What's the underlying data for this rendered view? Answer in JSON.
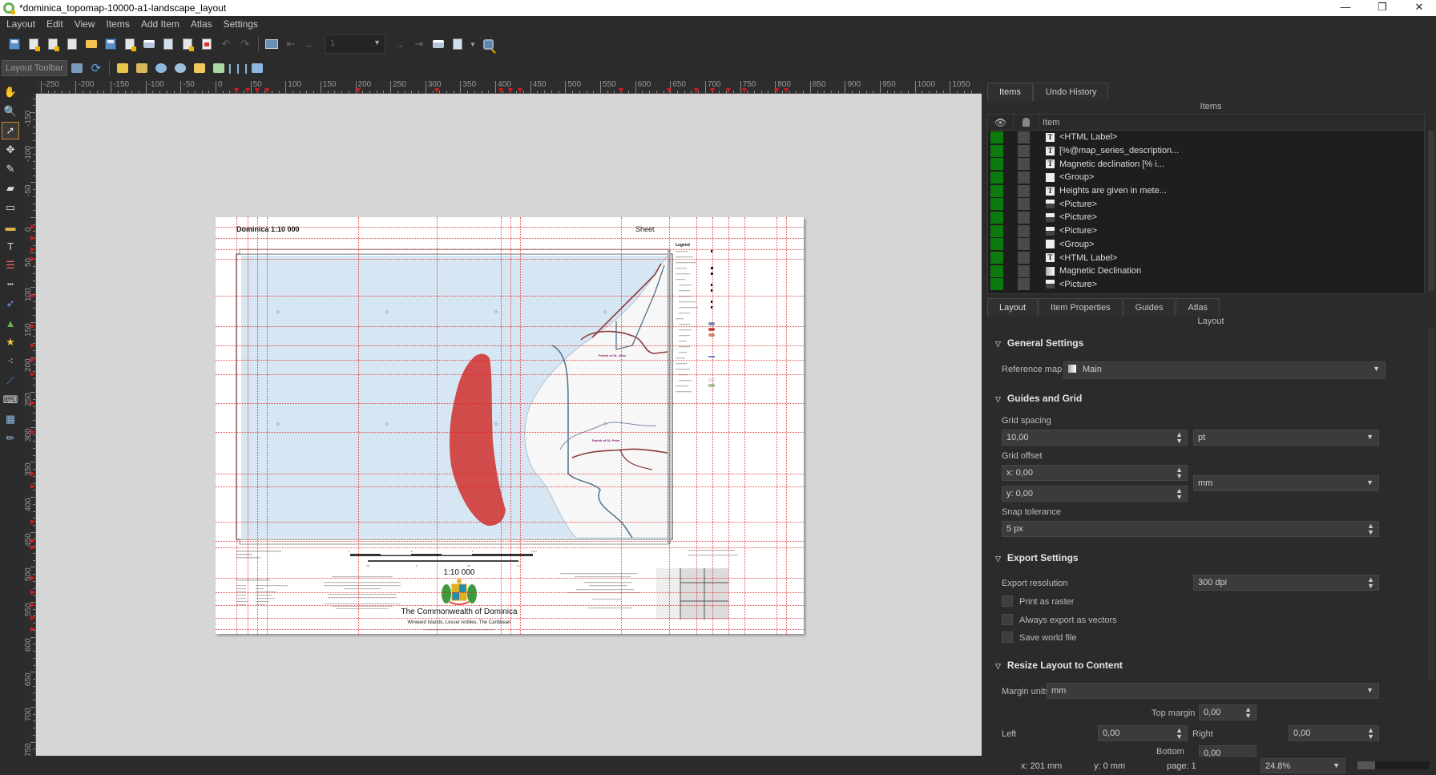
{
  "window": {
    "title": "*dominica_topomap-10000-a1-landscape_layout",
    "controls": {
      "minimize": "—",
      "restore": "❐",
      "close": "✕"
    }
  },
  "menu": [
    "Layout",
    "Edit",
    "View",
    "Items",
    "Add Item",
    "Atlas",
    "Settings"
  ],
  "toolbar": {
    "page_combo_value": "1",
    "layout_toolbar_label": "Layout Toolbar",
    "icons": [
      "save-icon",
      "new-layout-icon",
      "duplicate-layout-icon",
      "layout-manager-icon",
      "open-template-icon",
      "save-template-icon",
      "add-pages-icon",
      "print-icon",
      "export-image-icon",
      "export-svg-icon",
      "export-pdf-icon",
      "undo-icon",
      "redo-icon",
      "atlas-preview-icon",
      "first-feature-icon",
      "previous-feature-icon",
      "next-feature-icon",
      "last-feature-icon",
      "print-atlas-icon",
      "export-atlas-icon",
      "atlas-settings-icon"
    ]
  },
  "rulers": {
    "horizontal": [
      "-250",
      "-200",
      "-150",
      "-100",
      "-50",
      "0",
      "50",
      "100",
      "150",
      "200",
      "250",
      "300",
      "350",
      "400",
      "450",
      "500",
      "550",
      "600",
      "650",
      "700",
      "750",
      "800",
      "850",
      "900",
      "950",
      "1000",
      "1050"
    ],
    "vertical": [
      "-150",
      "-100",
      "-50",
      "0",
      "50",
      "100",
      "150",
      "200",
      "250",
      "300",
      "350",
      "400",
      "450",
      "500",
      "550",
      "600",
      "650",
      "700",
      "750"
    ]
  },
  "map_page": {
    "title": "Dominica 1:10 000",
    "sheet_label": "Sheet",
    "legend_title": "Legend",
    "scale_text": "1:10 000",
    "scalebar_km_labels": [
      "1",
      "0",
      "1",
      "2 km"
    ],
    "scalebar_mi_labels": [
      "0.5",
      "0",
      "0.5",
      "1 mi"
    ],
    "country_name": "The Commonwealth of Dominica",
    "region": "Winward Islands, Lesser Antilles, The Caribbean",
    "parish_labels": [
      "Parish of St. John",
      "Parish of St. Peter"
    ],
    "colors": {
      "sea": "#d6e6f3",
      "land": "#f7f7f7",
      "red_area": "#d24b4b",
      "road": "#8a3a3a",
      "river": "#5a7a90"
    }
  },
  "items_panel": {
    "tabs": [
      "Items",
      "Undo History"
    ],
    "title": "Items",
    "column_item": "Item",
    "rows": [
      {
        "type": "label",
        "name": "<HTML Label>"
      },
      {
        "type": "label",
        "name": "[%@map_series_description..."
      },
      {
        "type": "label",
        "name": "Magnetic declination [% i..."
      },
      {
        "type": "group",
        "name": "<Group>"
      },
      {
        "type": "label",
        "name": "Heights are given in mete..."
      },
      {
        "type": "picture",
        "name": "<Picture>"
      },
      {
        "type": "picture",
        "name": "<Picture>"
      },
      {
        "type": "picture",
        "name": "<Picture>"
      },
      {
        "type": "group",
        "name": "<Group>"
      },
      {
        "type": "label",
        "name": "<HTML Label>"
      },
      {
        "type": "gradient",
        "name": "Magnetic Declination"
      },
      {
        "type": "picture",
        "name": "<Picture>"
      }
    ]
  },
  "layout_panel": {
    "tabs": [
      "Layout",
      "Item Properties",
      "Guides",
      "Atlas"
    ],
    "title": "Layout",
    "general": {
      "header": "General Settings",
      "reference_map_label": "Reference map",
      "reference_map_value": "Main"
    },
    "guides": {
      "header": "Guides and Grid",
      "grid_spacing_label": "Grid spacing",
      "grid_spacing_value": "10,00",
      "grid_spacing_unit": "pt",
      "grid_offset_label": "Grid offset",
      "offset_x": "x: 0,00",
      "offset_y": "y: 0,00",
      "offset_unit": "mm",
      "snap_label": "Snap tolerance",
      "snap_value": "5 px"
    },
    "export": {
      "header": "Export Settings",
      "resolution_label": "Export resolution",
      "resolution_value": "300 dpi",
      "print_as_raster": {
        "label": "Print as raster",
        "checked": false
      },
      "always_vectors": {
        "label": "Always export as vectors",
        "checked": false
      },
      "save_world_file": {
        "label": "Save world file",
        "checked": false
      }
    },
    "resize": {
      "header": "Resize Layout to Content",
      "margin_units_label": "Margin units",
      "margin_units_value": "mm",
      "top_label": "Top margin",
      "top_value": "0,00",
      "left_label": "Left",
      "left_value": "0,00",
      "right_label": "Right",
      "right_value": "0,00",
      "bottom_label": "Bottom",
      "bottom_value": "0,00"
    }
  },
  "status": {
    "x": "x: 201 mm",
    "y": "y: 0 mm",
    "page": "page: 1",
    "zoom": "24.8%"
  }
}
